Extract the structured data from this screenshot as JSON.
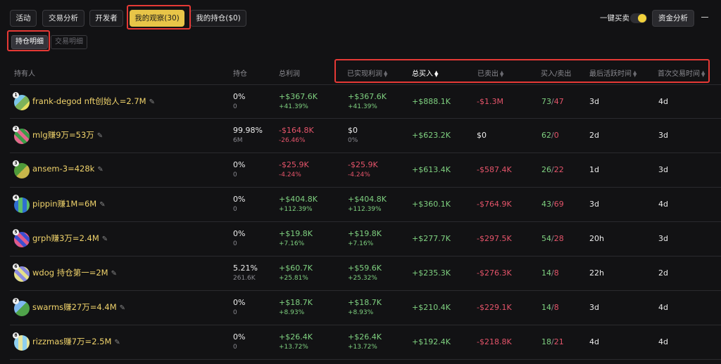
{
  "top_tabs": [
    "活动",
    "交易分析",
    "开发者",
    "我的观察(30)",
    "我的持仓($0)"
  ],
  "controls": {
    "one_click_trade": "一键买卖",
    "funds_analysis": "资金分析"
  },
  "sub_tabs": [
    "持仓明细",
    "交易明细"
  ],
  "headers": {
    "holder": "持有人",
    "position": "持仓",
    "total_profit": "总利润",
    "realized_profit": "已实现利润",
    "total_bought": "总买入",
    "total_sold": "已卖出",
    "buy_sell": "买入/卖出",
    "last_active": "最后活跃时间",
    "first_trade": "首次交易时间"
  },
  "rows": [
    {
      "rank": "1",
      "name": "frank-degod nft创始人=2.7M",
      "pos_pct": "0%",
      "pos_amt": "0",
      "tp": "+$367.6K",
      "tp_pct": "+41.39%",
      "rp": "+$367.6K",
      "rp_pct": "+41.39%",
      "bought": "+$888.1K",
      "sold": "-$1.3M",
      "buys": "73",
      "sells": "47",
      "last": "3d",
      "first": "4d"
    },
    {
      "rank": "2",
      "name": "mlg赚9万=53万",
      "pos_pct": "99.98%",
      "pos_amt": "6M",
      "tp": "-$164.8K",
      "tp_pct": "-26.46%",
      "rp": "$0",
      "rp_pct": "0%",
      "bought": "+$623.2K",
      "sold": "$0",
      "buys": "62",
      "sells": "0",
      "last": "2d",
      "first": "3d"
    },
    {
      "rank": "3",
      "name": "ansem-3=428k",
      "pos_pct": "0%",
      "pos_amt": "0",
      "tp": "-$25.9K",
      "tp_pct": "-4.24%",
      "rp": "-$25.9K",
      "rp_pct": "-4.24%",
      "bought": "+$613.4K",
      "sold": "-$587.4K",
      "buys": "26",
      "sells": "22",
      "last": "1d",
      "first": "3d"
    },
    {
      "rank": "4",
      "name": "pippin赚1M=6M",
      "pos_pct": "0%",
      "pos_amt": "0",
      "tp": "+$404.8K",
      "tp_pct": "+112.39%",
      "rp": "+$404.8K",
      "rp_pct": "+112.39%",
      "bought": "+$360.1K",
      "sold": "-$764.9K",
      "buys": "43",
      "sells": "69",
      "last": "3d",
      "first": "4d"
    },
    {
      "rank": "5",
      "name": "grph赚3万=2.4M",
      "pos_pct": "0%",
      "pos_amt": "0",
      "tp": "+$19.8K",
      "tp_pct": "+7.16%",
      "rp": "+$19.8K",
      "rp_pct": "+7.16%",
      "bought": "+$277.7K",
      "sold": "-$297.5K",
      "buys": "54",
      "sells": "28",
      "last": "20h",
      "first": "3d"
    },
    {
      "rank": "6",
      "name": "wdog 持仓第一=2M",
      "pos_pct": "5.21%",
      "pos_amt": "261.6K",
      "tp": "+$60.7K",
      "tp_pct": "+25.81%",
      "rp": "+$59.6K",
      "rp_pct": "+25.32%",
      "bought": "+$235.3K",
      "sold": "-$276.3K",
      "buys": "14",
      "sells": "8",
      "last": "22h",
      "first": "2d"
    },
    {
      "rank": "7",
      "name": "swarms赚27万=4.4M",
      "pos_pct": "0%",
      "pos_amt": "0",
      "tp": "+$18.7K",
      "tp_pct": "+8.93%",
      "rp": "+$18.7K",
      "rp_pct": "+8.93%",
      "bought": "+$210.4K",
      "sold": "-$229.1K",
      "buys": "14",
      "sells": "8",
      "last": "3d",
      "first": "4d"
    },
    {
      "rank": "8",
      "name": "rizzmas赚7万=2.5M",
      "pos_pct": "0%",
      "pos_amt": "0",
      "tp": "+$26.4K",
      "tp_pct": "+13.72%",
      "rp": "+$26.4K",
      "rp_pct": "+13.72%",
      "bought": "+$192.4K",
      "sold": "-$218.8K",
      "buys": "18",
      "sells": "21",
      "last": "4d",
      "first": "4d"
    }
  ],
  "colors": {
    "accent": "#e8c548",
    "positive": "#7fd180",
    "negative": "#e5546a",
    "highlight_box": "#e53935"
  }
}
